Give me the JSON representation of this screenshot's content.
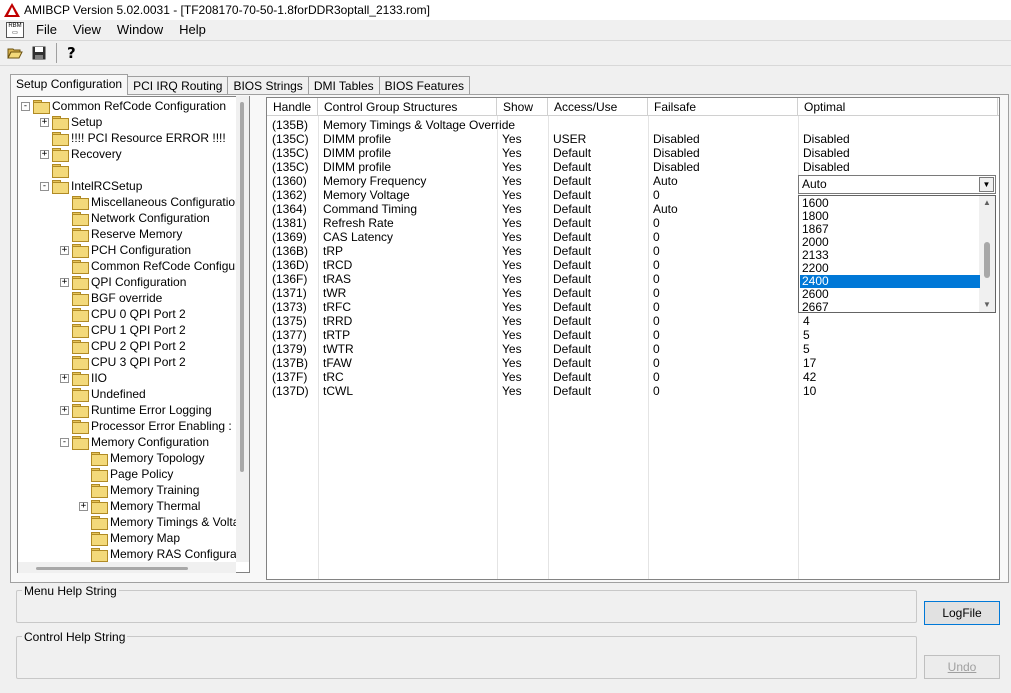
{
  "window": {
    "title": "AMIBCP Version 5.02.0031 - [TF208170-70-50-1.8forDDR3optall_2133.rom]"
  },
  "menu": [
    "File",
    "View",
    "Window",
    "Help"
  ],
  "toolbar": [
    "open-folder-icon",
    "save-icon",
    "help-icon"
  ],
  "tabs": [
    {
      "label": "Setup Configuration",
      "active": true
    },
    {
      "label": "PCI IRQ Routing"
    },
    {
      "label": "BIOS Strings"
    },
    {
      "label": "DMI Tables"
    },
    {
      "label": "BIOS Features"
    }
  ],
  "tree": [
    {
      "label": "Common RefCode Configuration",
      "level": 0,
      "exp": "-"
    },
    {
      "label": "Setup",
      "level": 1,
      "exp": "+"
    },
    {
      "label": "!!!! PCI Resource ERROR !!!!",
      "level": 1,
      "exp": ""
    },
    {
      "label": "Recovery",
      "level": 1,
      "exp": "+"
    },
    {
      "label": "",
      "level": 1,
      "exp": ""
    },
    {
      "label": "IntelRCSetup",
      "level": 1,
      "exp": "-"
    },
    {
      "label": "Miscellaneous Configuration",
      "level": 2,
      "exp": ""
    },
    {
      "label": "Network Configuration",
      "level": 2,
      "exp": ""
    },
    {
      "label": "Reserve Memory",
      "level": 2,
      "exp": ""
    },
    {
      "label": "PCH Configuration",
      "level": 2,
      "exp": "+"
    },
    {
      "label": "Common RefCode Configurati",
      "level": 2,
      "exp": ""
    },
    {
      "label": "QPI Configuration",
      "level": 2,
      "exp": "+"
    },
    {
      "label": "BGF override",
      "level": 2,
      "exp": ""
    },
    {
      "label": "CPU 0 QPI Port 2",
      "level": 2,
      "exp": ""
    },
    {
      "label": "CPU 1 QPI Port 2",
      "level": 2,
      "exp": ""
    },
    {
      "label": "CPU 2 QPI Port 2",
      "level": 2,
      "exp": ""
    },
    {
      "label": "CPU 3 QPI Port 2",
      "level": 2,
      "exp": ""
    },
    {
      "label": "IIO",
      "level": 2,
      "exp": "+"
    },
    {
      "label": "Undefined",
      "level": 2,
      "exp": ""
    },
    {
      "label": "Runtime Error Logging",
      "level": 2,
      "exp": "+"
    },
    {
      "label": "Processor Error Enabling :",
      "level": 2,
      "exp": ""
    },
    {
      "label": "Memory Configuration",
      "level": 2,
      "exp": "-"
    },
    {
      "label": "Memory Topology",
      "level": 3,
      "exp": ""
    },
    {
      "label": "Page Policy",
      "level": 3,
      "exp": ""
    },
    {
      "label": "Memory Training",
      "level": 3,
      "exp": ""
    },
    {
      "label": "Memory Thermal",
      "level": 3,
      "exp": "+"
    },
    {
      "label": "Memory Timings & Voltage",
      "level": 3,
      "exp": ""
    },
    {
      "label": "Memory Map",
      "level": 3,
      "exp": ""
    },
    {
      "label": "Memory RAS Configuratio",
      "level": 3,
      "exp": ""
    }
  ],
  "grid": {
    "headers": [
      "Handle",
      "Control Group Structures",
      "Show",
      "Access/Use",
      "Failsafe",
      "Optimal"
    ],
    "rows": [
      [
        "(135B)",
        "Memory Timings & Voltage Override",
        "",
        "",
        "",
        ""
      ],
      [
        "(135C)",
        "DIMM profile",
        "Yes",
        "USER",
        "Disabled",
        "Disabled"
      ],
      [
        "(135C)",
        "DIMM profile",
        "Yes",
        "Default",
        "Disabled",
        "Disabled"
      ],
      [
        "(135C)",
        "DIMM profile",
        "Yes",
        "Default",
        "Disabled",
        "Disabled"
      ],
      [
        "(1360)",
        "Memory Frequency",
        "Yes",
        "Default",
        "Auto",
        ""
      ],
      [
        "(1362)",
        "Memory Voltage",
        "Yes",
        "Default",
        "0",
        ""
      ],
      [
        "(1364)",
        "Command Timing",
        "Yes",
        "Default",
        "Auto",
        ""
      ],
      [
        "(1381)",
        "Refresh Rate",
        "Yes",
        "Default",
        "0",
        ""
      ],
      [
        "(1369)",
        "CAS Latency",
        "Yes",
        "Default",
        "0",
        ""
      ],
      [
        "(136B)",
        "tRP",
        "Yes",
        "Default",
        "0",
        ""
      ],
      [
        "(136D)",
        "tRCD",
        "Yes",
        "Default",
        "0",
        ""
      ],
      [
        "(136F)",
        "tRAS",
        "Yes",
        "Default",
        "0",
        ""
      ],
      [
        "(1371)",
        "tWR",
        "Yes",
        "Default",
        "0",
        ""
      ],
      [
        "(1373)",
        "tRFC",
        "Yes",
        "Default",
        "0",
        ""
      ],
      [
        "(1375)",
        "tRRD",
        "Yes",
        "Default",
        "0",
        "4"
      ],
      [
        "(1377)",
        "tRTP",
        "Yes",
        "Default",
        "0",
        "5"
      ],
      [
        "(1379)",
        "tWTR",
        "Yes",
        "Default",
        "0",
        "5"
      ],
      [
        "(137B)",
        "tFAW",
        "Yes",
        "Default",
        "0",
        "17"
      ],
      [
        "(137F)",
        "tRC",
        "Yes",
        "Default",
        "0",
        "42"
      ],
      [
        "(137D)",
        "tCWL",
        "Yes",
        "Default",
        "0",
        "10"
      ]
    ]
  },
  "dropdown": {
    "value": "Auto",
    "options": [
      "1600",
      "1800",
      "1867",
      "2000",
      "2133",
      "2200",
      "2400",
      "2600",
      "2667"
    ],
    "highlighted": "2400"
  },
  "help": {
    "menu_label": "Menu Help String",
    "control_label": "Control Help String"
  },
  "buttons": {
    "logfile": "LogFile",
    "undo": "Undo"
  }
}
